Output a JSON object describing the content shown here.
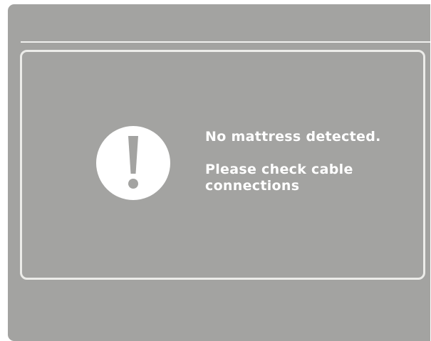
{
  "dialog": {
    "icon": "exclamation-alert-icon",
    "message_primary": "No mattress detected.",
    "message_secondary": "Please check cable connections"
  },
  "colors": {
    "panel_background": "#a3a3a1",
    "border": "#ecece9",
    "text": "#ffffff",
    "icon_fill": "#ffffff"
  }
}
